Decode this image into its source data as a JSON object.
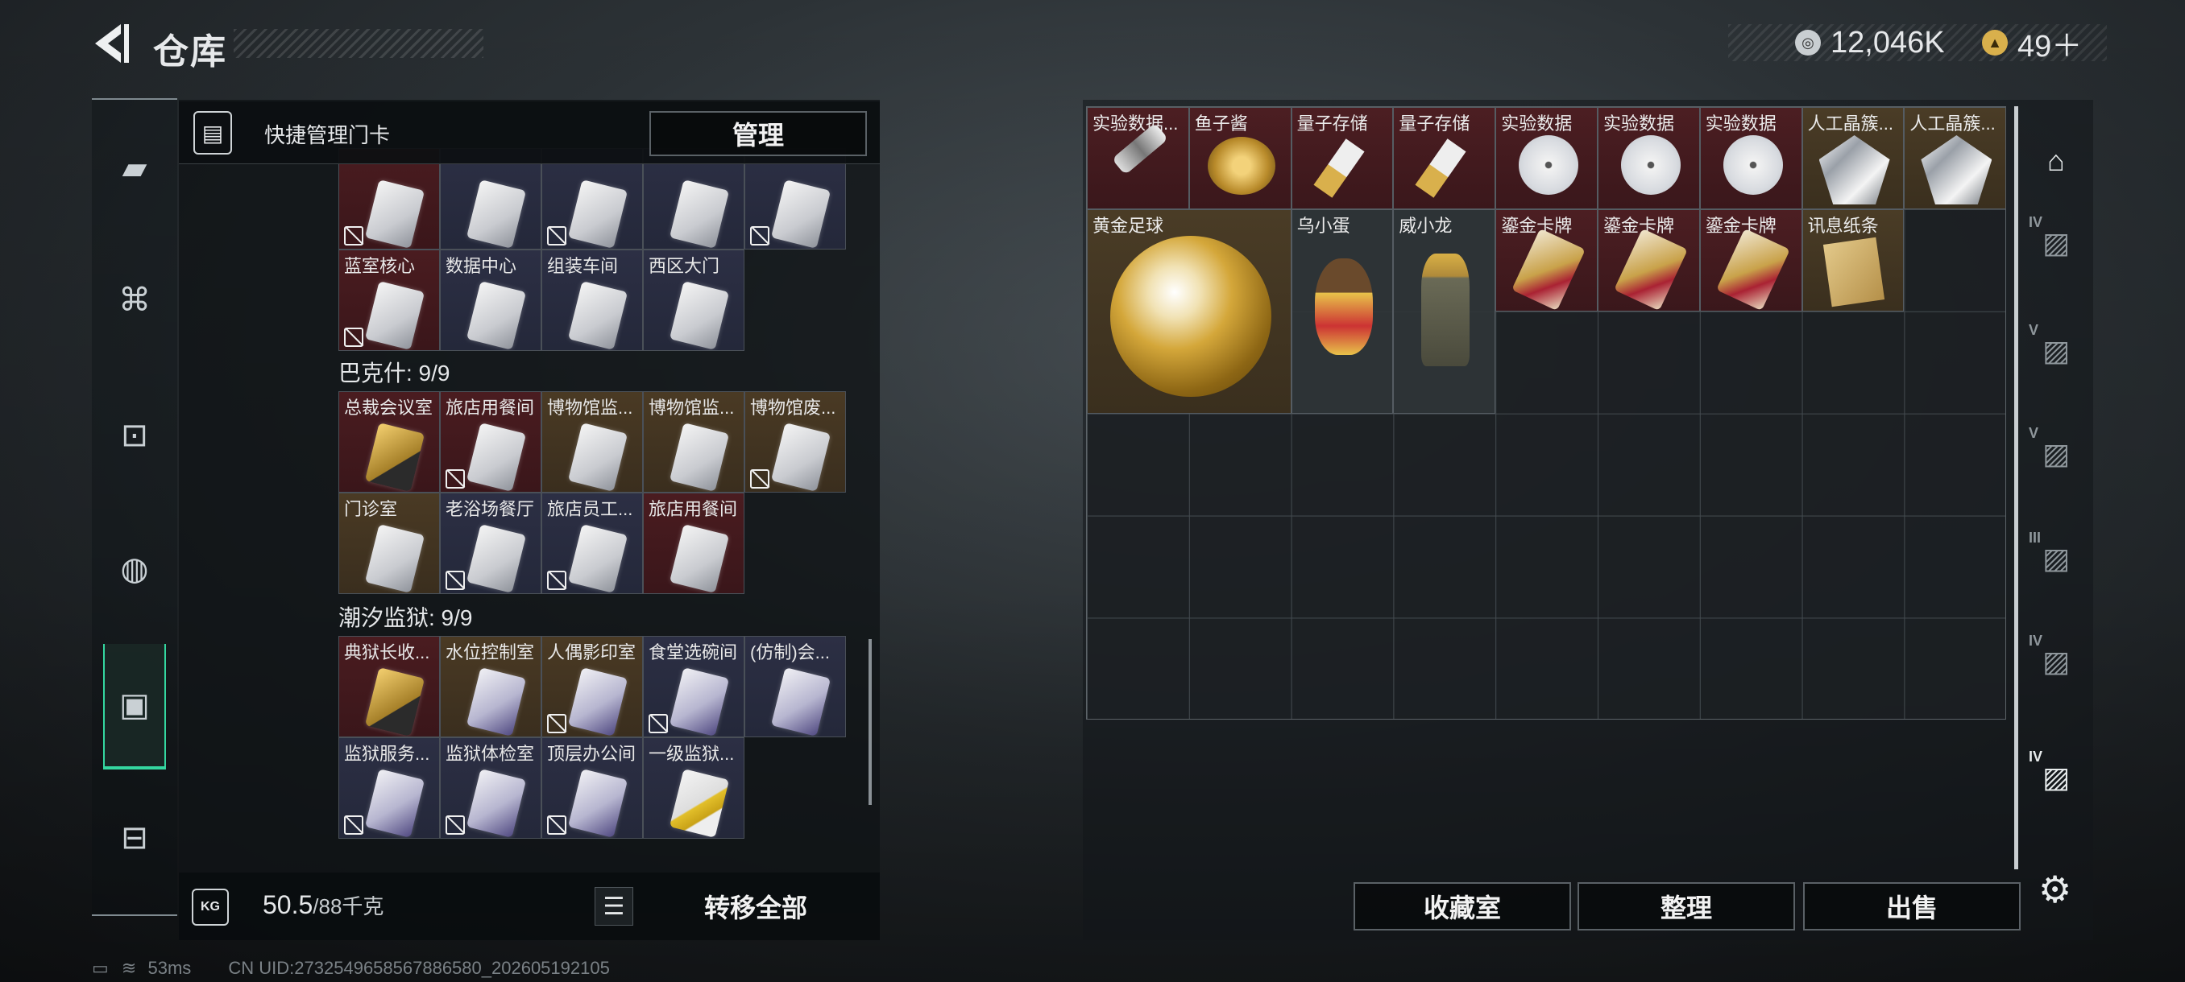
{
  "header": {
    "title": "仓库",
    "currencies": [
      {
        "value": "12,046K",
        "icon": "silver-coin-icon"
      },
      {
        "value": "49＋",
        "icon": "gold-coin-icon"
      }
    ]
  },
  "sidenav": {
    "items": [
      {
        "icon": "pistol-icon"
      },
      {
        "icon": "armor-vest-icon"
      },
      {
        "icon": "backpack-icon"
      },
      {
        "icon": "bag-icon"
      },
      {
        "icon": "keycard-holder-icon",
        "active": true
      },
      {
        "icon": "toolbox-icon"
      }
    ]
  },
  "left_panel": {
    "header_label": "快捷管理门卡",
    "manage_button": "管理",
    "rows_top": [
      {
        "name": "",
        "color": "red",
        "link": true
      },
      {
        "name": "",
        "color": "blue",
        "link": false
      },
      {
        "name": "",
        "color": "blue",
        "link": true
      },
      {
        "name": "",
        "color": "blue",
        "link": false
      },
      {
        "name": "",
        "color": "blue",
        "link": true
      }
    ],
    "rows_top2": [
      {
        "name": "蓝室核心",
        "color": "red",
        "link": true
      },
      {
        "name": "数据中心",
        "color": "blue",
        "link": false
      },
      {
        "name": "组装车间",
        "color": "blue",
        "link": false
      },
      {
        "name": "西区大门",
        "color": "blue",
        "link": false
      }
    ],
    "sections": [
      {
        "title": "巴克什: 9/9",
        "cards": [
          {
            "name": "总裁会议室",
            "color": "red",
            "card": "gk",
            "link": false
          },
          {
            "name": "旅店用餐间",
            "color": "red",
            "card": "wk",
            "link": true
          },
          {
            "name": "博物馆监...",
            "color": "gold",
            "card": "wk",
            "link": false
          },
          {
            "name": "博物馆监...",
            "color": "gold",
            "card": "wk",
            "link": false
          },
          {
            "name": "博物馆废...",
            "color": "gold",
            "card": "wk",
            "link": true
          },
          {
            "name": "门诊室",
            "color": "gold",
            "card": "wk",
            "link": false
          },
          {
            "name": "老浴场餐厅",
            "color": "blue",
            "card": "wk",
            "link": true
          },
          {
            "name": "旅店员工...",
            "color": "blue",
            "card": "wk",
            "link": true
          },
          {
            "name": "旅店用餐间",
            "color": "red",
            "card": "wk",
            "link": false
          }
        ]
      },
      {
        "title": "潮汐监狱: 9/9",
        "cards": [
          {
            "name": "典狱长收...",
            "color": "red",
            "card": "gk",
            "link": false
          },
          {
            "name": "水位控制室",
            "color": "gold",
            "card": "pk",
            "link": false
          },
          {
            "name": "人偶影印室",
            "color": "gold",
            "card": "pk",
            "link": true
          },
          {
            "name": "食堂选碗间",
            "color": "blue",
            "card": "pk",
            "link": true
          },
          {
            "name": "(仿制)会...",
            "color": "blue",
            "card": "pk",
            "link": false
          },
          {
            "name": "监狱服务...",
            "color": "blue",
            "card": "pk",
            "link": true
          },
          {
            "name": "监狱体检室",
            "color": "blue",
            "card": "pk",
            "link": true
          },
          {
            "name": "顶层办公间",
            "color": "blue",
            "card": "pk",
            "link": true
          },
          {
            "name": "一级监狱...",
            "color": "blue",
            "card": "yk",
            "link": false
          }
        ]
      }
    ],
    "weight": {
      "current": "50.5",
      "max": "/88千克"
    },
    "transfer_all": "转移全部"
  },
  "stash": {
    "items": [
      {
        "name": "实验数据...",
        "color": "red",
        "icon": "flashlight-icon"
      },
      {
        "name": "鱼子酱",
        "color": "red",
        "icon": "caviar-tin-icon"
      },
      {
        "name": "量子存储",
        "color": "red",
        "icon": "usb-drive-icon"
      },
      {
        "name": "量子存储",
        "color": "red",
        "icon": "usb-drive-icon"
      },
      {
        "name": "实验数据",
        "color": "red",
        "icon": "disc-icon"
      },
      {
        "name": "实验数据",
        "color": "red",
        "icon": "disc-icon"
      },
      {
        "name": "实验数据",
        "color": "red",
        "icon": "disc-icon"
      },
      {
        "name": "人工晶簇...",
        "color": "gold",
        "icon": "crystal-icon"
      },
      {
        "name": "人工晶簇...",
        "color": "gold",
        "icon": "crystal-icon"
      },
      {
        "name": "黄金足球",
        "color": "gold",
        "icon": "golden-football-icon"
      },
      {
        "name": "乌小蛋",
        "color": "gray",
        "icon": "egg-figure-icon"
      },
      {
        "name": "威小龙",
        "color": "gray",
        "icon": "soldier-figure-icon"
      },
      {
        "name": "鎏金卡牌",
        "color": "red",
        "icon": "gilded-card-icon"
      },
      {
        "name": "鎏金卡牌",
        "color": "red",
        "icon": "gilded-card-icon"
      },
      {
        "name": "鎏金卡牌",
        "color": "red",
        "icon": "gilded-card-icon"
      },
      {
        "name": "讯息纸条",
        "color": "gold",
        "icon": "paper-note-icon"
      }
    ],
    "buttons": {
      "collection": "收藏室",
      "organize": "整理",
      "sell": "出售"
    }
  },
  "right_tabs": [
    {
      "icon": "safe-icon",
      "level": ""
    },
    {
      "icon": "case-iv-icon",
      "level": "IV"
    },
    {
      "icon": "case-v-icon",
      "level": "V"
    },
    {
      "icon": "case-v2-icon",
      "level": "V"
    },
    {
      "icon": "case-iii-icon",
      "level": "III"
    },
    {
      "icon": "case-iv2-icon",
      "level": "IV"
    },
    {
      "icon": "case-iv3-icon",
      "level": "IV"
    }
  ],
  "status": {
    "ping": "53ms",
    "uid": "CN UID:2732549658567886580_202605192105"
  },
  "colors": {
    "accent": "#34d7a0",
    "red_rarity": "#4a1c20",
    "gold_rarity": "#4a3a24",
    "blue_rarity": "#2c2f44"
  }
}
